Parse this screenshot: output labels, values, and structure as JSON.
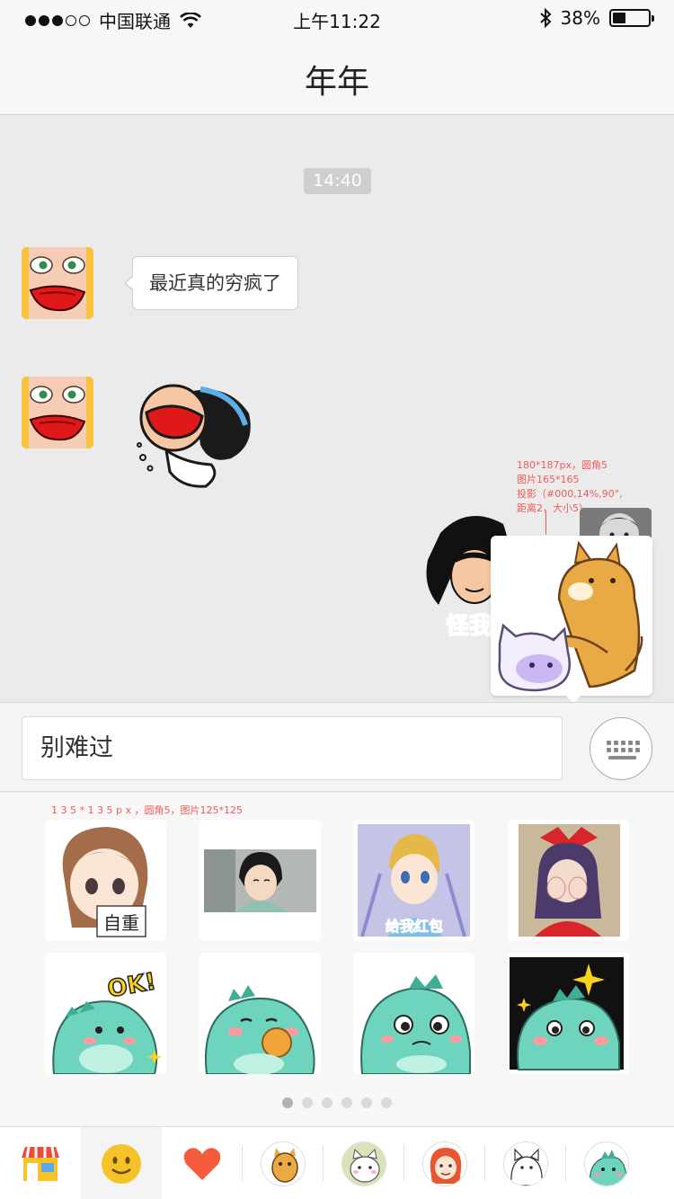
{
  "status_bar": {
    "carrier": "中国联通",
    "time": "上午11:22",
    "battery": "38%",
    "battery_level": 0.38
  },
  "header": {
    "title": "年年"
  },
  "chat": {
    "timestamp": "14:40",
    "messages": [
      {
        "side": "left",
        "type": "text",
        "text": "最近真的穷疯了"
      },
      {
        "side": "left",
        "type": "sticker",
        "sticker": "crying-cartoon-sticker"
      },
      {
        "side": "right",
        "type": "sticker",
        "sticker": "black-hair-girl-sticker",
        "text": "怪我"
      }
    ],
    "annotation_preview": [
      "180*187px，圆角5",
      "图片165*165",
      "投影（#000,14%,90°,",
      "距离2，大小5）"
    ]
  },
  "input": {
    "value": "别难过",
    "keyboard_icon": "keyboard-icon"
  },
  "sticker_panel": {
    "annotation": "1 3 5 * 1 3 5 p x ，圆角5，图片125*125",
    "stickers": [
      {
        "name": "anime-girl-sign-sticker",
        "caption": "自重"
      },
      {
        "name": "anime-boy-smile-sticker",
        "caption": ""
      },
      {
        "name": "anime-kid-red-envelope-sticker",
        "caption": "给我红包"
      },
      {
        "name": "anime-shy-girl-sticker",
        "caption": ""
      },
      {
        "name": "dino-ok-sticker",
        "caption": "OK!"
      },
      {
        "name": "dino-eating-cookie-sticker",
        "caption": ""
      },
      {
        "name": "dino-crying-sticker",
        "caption": ""
      },
      {
        "name": "dino-sparkle-sticker",
        "caption": ""
      }
    ],
    "pages": 6,
    "current_page": 1
  },
  "tab_bar": {
    "tabs": [
      {
        "name": "store-icon"
      },
      {
        "name": "emoji-face-icon",
        "selected": true
      },
      {
        "name": "heart-icon"
      },
      {
        "name": "sticker-pack-dog"
      },
      {
        "name": "sticker-pack-cat"
      },
      {
        "name": "sticker-pack-redhair-girl"
      },
      {
        "name": "sticker-pack-white-cat"
      },
      {
        "name": "sticker-pack-dino"
      }
    ]
  },
  "colors": {
    "annotation": "#f05a5a",
    "heart": "#f55a3c",
    "emoji": "#f6c22a",
    "dino": "#6fd4bd"
  }
}
